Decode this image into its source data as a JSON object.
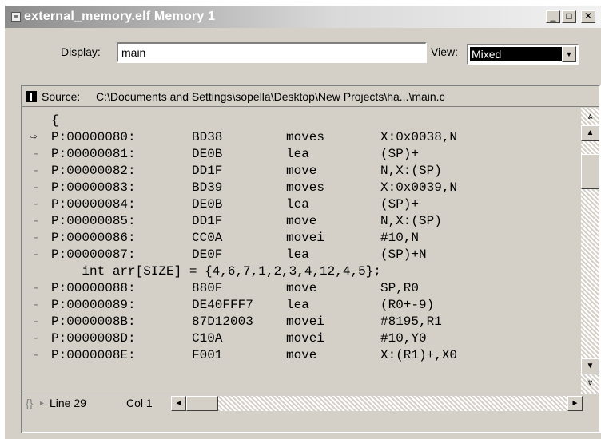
{
  "window": {
    "title": "external_memory.elf Memory 1",
    "controls": {
      "minimize": "_",
      "maximize": "□",
      "close": "✕"
    }
  },
  "display": {
    "label": "Display:",
    "value": "main"
  },
  "view": {
    "label": "View:",
    "selected": "Mixed"
  },
  "source": {
    "label": "Source:",
    "path": "C:\\Documents and Settings\\sopella\\Desktop\\New Projects\\ha...\\main.c"
  },
  "code_lines": [
    {
      "type": "source",
      "text": "{"
    },
    {
      "type": "asm",
      "current": true,
      "addr": "P:00000080:",
      "opcode": "BD38",
      "mnemonic": "moves",
      "args": "X:0x0038,N"
    },
    {
      "type": "asm",
      "addr": "P:00000081:",
      "opcode": "DE0B",
      "mnemonic": "lea",
      "args": "(SP)+"
    },
    {
      "type": "asm",
      "addr": "P:00000082:",
      "opcode": "DD1F",
      "mnemonic": "move",
      "args": "N,X:(SP)"
    },
    {
      "type": "asm",
      "addr": "P:00000083:",
      "opcode": "BD39",
      "mnemonic": "moves",
      "args": "X:0x0039,N"
    },
    {
      "type": "asm",
      "addr": "P:00000084:",
      "opcode": "DE0B",
      "mnemonic": "lea",
      "args": "(SP)+"
    },
    {
      "type": "asm",
      "addr": "P:00000085:",
      "opcode": "DD1F",
      "mnemonic": "move",
      "args": "N,X:(SP)"
    },
    {
      "type": "asm",
      "addr": "P:00000086:",
      "opcode": "CC0A",
      "mnemonic": "movei",
      "args": "#10,N"
    },
    {
      "type": "asm",
      "addr": "P:00000087:",
      "opcode": "DE0F",
      "mnemonic": "lea",
      "args": "(SP)+N"
    },
    {
      "type": "source",
      "text": "    int arr[SIZE] = {4,6,7,1,2,3,4,12,4,5};"
    },
    {
      "type": "asm",
      "addr": "P:00000088:",
      "opcode": "880F",
      "mnemonic": "move",
      "args": "SP,R0"
    },
    {
      "type": "asm",
      "addr": "P:00000089:",
      "opcode": "DE40FFF7",
      "mnemonic": "lea",
      "args": "(R0+-9)"
    },
    {
      "type": "asm",
      "addr": "P:0000008B:",
      "opcode": "87D12003",
      "mnemonic": "movei",
      "args": "#8195,R1"
    },
    {
      "type": "asm",
      "addr": "P:0000008D:",
      "opcode": "C10A",
      "mnemonic": "movei",
      "args": "#10,Y0"
    },
    {
      "type": "asm",
      "addr": "P:0000008E:",
      "opcode": "F001",
      "mnemonic": "move",
      "args": "X:(R1)+,X0"
    }
  ],
  "status": {
    "line": "Line 29",
    "col": "Col 1"
  },
  "icons": {
    "window": "window-icon",
    "source": "source-toggle-icon",
    "current_pc": "current-pc-arrow-icon",
    "braces": "braces-icon"
  }
}
